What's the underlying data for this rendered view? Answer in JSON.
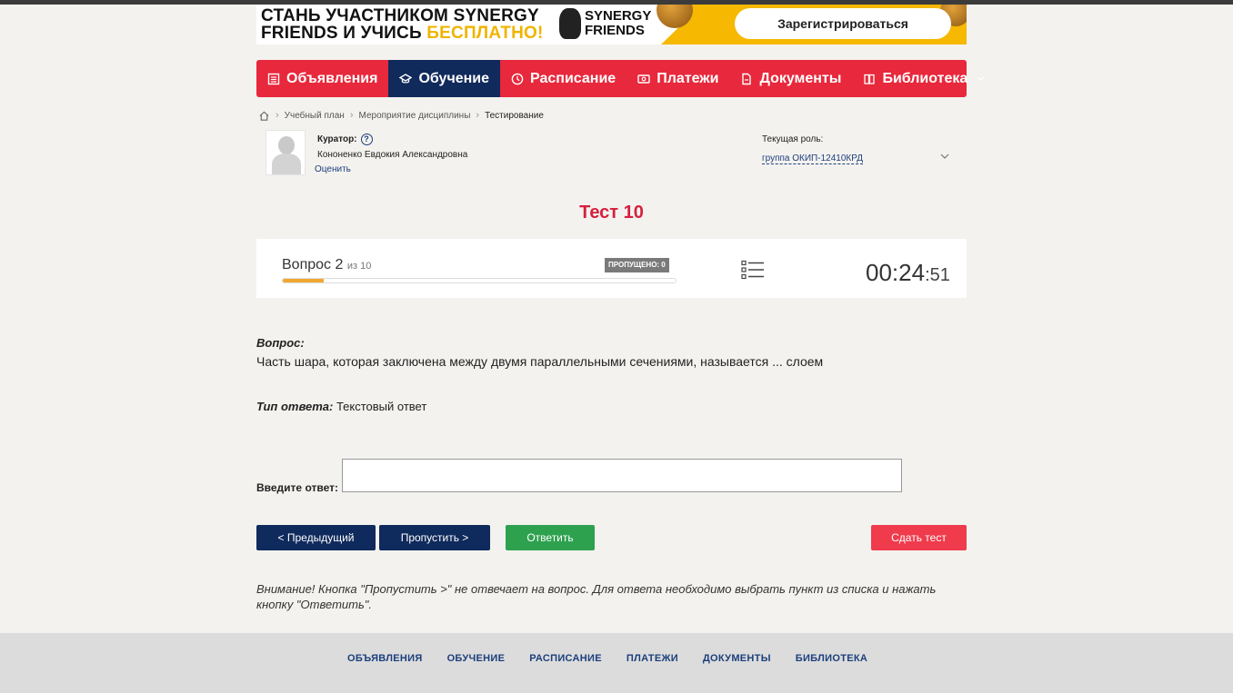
{
  "banner": {
    "line1": "СТАНЬ УЧАСТНИКОМ SYNERGY",
    "line2_start": "FRIENDS И УЧИСЬ ",
    "line2_free": "БЕСПЛАТНО!",
    "logo_line1": "SYNERGY",
    "logo_line2": "FRIENDS",
    "register_label": "Зарегистрироваться",
    "accent_color": "#f6b800"
  },
  "nav": {
    "items": [
      {
        "label": "Объявления",
        "icon": "list-icon"
      },
      {
        "label": "Обучение",
        "icon": "graduation-cap-icon",
        "active": true
      },
      {
        "label": "Расписание",
        "icon": "clock-icon"
      },
      {
        "label": "Платежи",
        "icon": "money-icon"
      },
      {
        "label": "Документы",
        "icon": "document-icon"
      },
      {
        "label": "Библиотека",
        "icon": "book-icon"
      }
    ],
    "color": "#e8283c",
    "active_color": "#102a5c"
  },
  "breadcrumb": {
    "items": [
      "Учебный план",
      "Мероприятие дисциплины",
      "Тестирование"
    ]
  },
  "curator": {
    "label": "Куратор:",
    "name": "Кононенко Евдокия Александровна",
    "rate_label": "Оценить",
    "role_label": "Текущая роль:",
    "role_value": "группа ОКИП-12410КРД"
  },
  "test": {
    "title": "Тест 10",
    "question_label": "Вопрос 2",
    "question_of": "из 10",
    "skipped_badge": "ПРОПУЩЕНО: 0",
    "progress": 0.105,
    "timer_main": "00:24",
    "timer_sec": ":51"
  },
  "question": {
    "caption": "Вопрос:",
    "text": "Часть шара, которая заключена между двумя параллельными сечениями, называется ... слоем",
    "answer_type_label": "Тип ответа:",
    "answer_type_value": " Текстовый ответ",
    "answer_label": "Введите ответ:",
    "answer_value": ""
  },
  "buttons": {
    "prev": "< Предыдущий",
    "skip": "Пропустить >",
    "answer": "Ответить",
    "submit": "Сдать тест"
  },
  "notice": "Внимание! Кнопка \"Пропустить >\" не отвечает на вопрос. Для ответа необходимо выбрать пункт из списка и нажать кнопку \"Ответить\".",
  "footer": {
    "links": [
      "ОБЪЯВЛЕНИЯ",
      "ОБУЧЕНИЕ",
      "РАСПИСАНИЕ",
      "ПЛАТЕЖИ",
      "ДОКУМЕНТЫ",
      "БИБЛИОТЕКА"
    ]
  }
}
